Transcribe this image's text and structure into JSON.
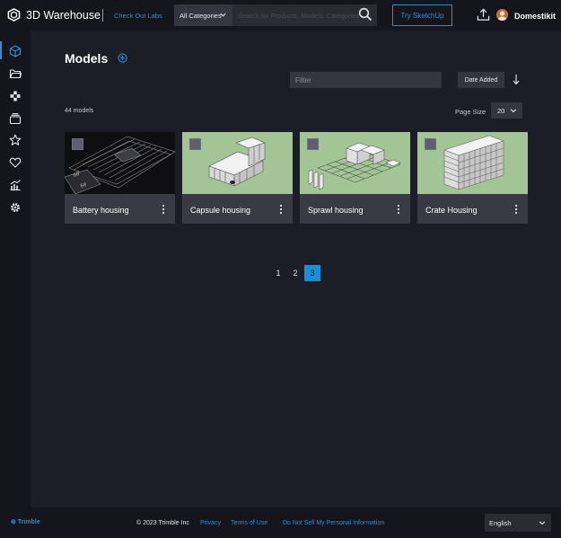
{
  "header": {
    "logo_text": "3D Warehouse",
    "labs_link": "Check Out Labs",
    "category_label": "All Categories",
    "search_placeholder": "Search for Products, Models, Categories",
    "try_button": "Try SketchUp",
    "username": "Domestikit"
  },
  "sidebar": {
    "items": [
      {
        "icon": "cube-icon",
        "active": true
      },
      {
        "icon": "folder-icon",
        "active": false
      },
      {
        "icon": "material-icon",
        "active": false
      },
      {
        "icon": "collections-icon",
        "active": false
      },
      {
        "icon": "star-icon",
        "active": false
      },
      {
        "icon": "heart-icon",
        "active": false
      },
      {
        "icon": "analytics-icon",
        "active": false
      },
      {
        "icon": "settings-icon",
        "active": false
      }
    ]
  },
  "main": {
    "title": "Models",
    "filter_placeholder": "Filter",
    "sort_label": "Date Added",
    "count_text": "44 models",
    "page_size_label": "Page Size",
    "page_size_value": "20",
    "models": [
      {
        "name": "Battery housing",
        "thumb": "dark"
      },
      {
        "name": "Capsule housing",
        "thumb": "capsule"
      },
      {
        "name": "Sprawl housing",
        "thumb": "sprawl"
      },
      {
        "name": "Crate Housing",
        "thumb": "crate"
      }
    ],
    "pagination": {
      "pages": [
        "1",
        "2",
        "3"
      ],
      "current": "3"
    }
  },
  "footer": {
    "brand": "⊕ Trimble",
    "copyright": "© 2023 Trimble Inc",
    "links": [
      "Privacy",
      "Terms of Use",
      "Do Not Sell My Personal Information"
    ],
    "language": "English"
  },
  "colors": {
    "accent": "#2c8fd6",
    "background": "#1d1d27",
    "bar": "#15151d",
    "card": "#3a3a45",
    "thumb_green": "#a3c596"
  }
}
